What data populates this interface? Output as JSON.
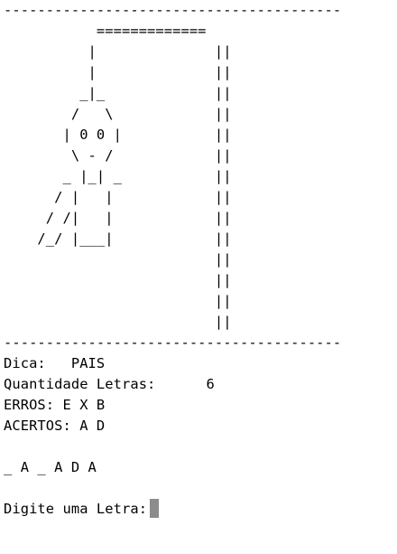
{
  "terminal": {
    "art": [
      "----------------------------------------",
      "           =============",
      "          |              ||",
      "          |              ||",
      "         _|_             ||",
      "        /   \\            ||",
      "       | 0 0 |           ||",
      "        \\ - /            ||",
      "       _ |_| _           ||",
      "      / |   |            ||",
      "     / /|   |            ||",
      "    /_/ |___|            ||",
      "                         ||",
      "                         ||",
      "                         ||",
      "                         ||",
      "----------------------------------------"
    ],
    "hint": "Dica:   PAIS",
    "letter_count": "Quantidade Letras:      6",
    "errors": "ERROS: E X B",
    "hits": "ACERTOS: A D",
    "word_progress": "_ A _ A D A",
    "prompt": "Digite uma Letra:"
  }
}
